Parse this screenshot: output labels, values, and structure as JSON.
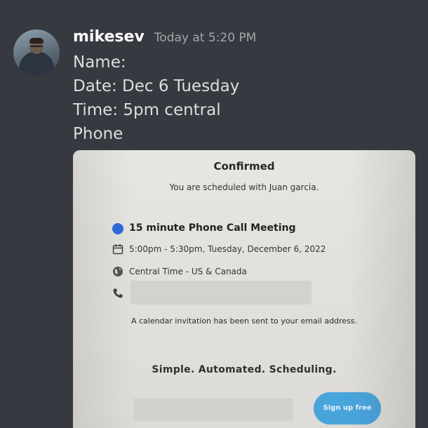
{
  "message": {
    "username": "mikesev",
    "timestamp": "Today at 5:20 PM",
    "lines": [
      "Name:",
      "Date: Dec 6 Tuesday",
      "Time: 5pm central",
      "Phone"
    ]
  },
  "attachment": {
    "confirmed_title": "Confirmed",
    "scheduled_text": "You are scheduled with Juan garcia.",
    "event_title": "15 minute Phone Call Meeting",
    "event_color": "#2f6be0",
    "datetime": "5:00pm - 5:30pm, Tuesday, December 6, 2022",
    "timezone": "Central Time - US & Canada",
    "notice": "A calendar invitation has been sent to your email address.",
    "tagline": "Simple. Automated. Scheduling.",
    "signup_label": "Sign up free",
    "icons": [
      "calendar-icon",
      "globe-icon",
      "phone-icon"
    ]
  },
  "colors": {
    "background": "#36393f",
    "username": "#ffffff",
    "timestamp": "#a3a6aa",
    "message_text": "#dcddde",
    "signup_button": "#4aa4dc"
  }
}
